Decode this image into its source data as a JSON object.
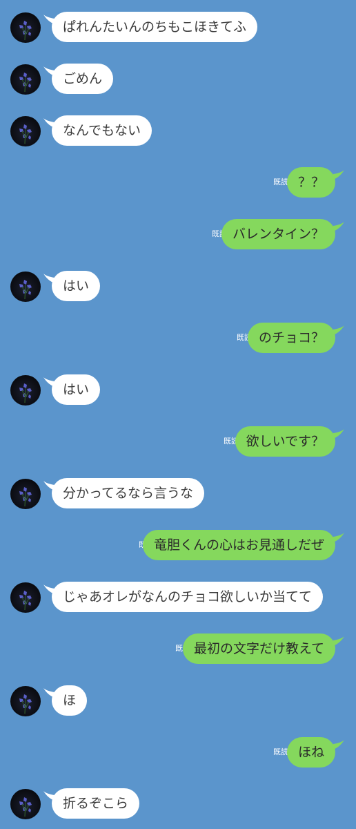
{
  "read_label": "既読",
  "colors": {
    "background": "#5b95cc",
    "incoming_bubble": "#ffffff",
    "outgoing_bubble": "#85d85d",
    "read_text": "#ffffff"
  },
  "avatar_icon": "flower-avatar-icon",
  "messages": [
    {
      "side": "in",
      "text": "ぱれんたいんのちもこほきてふ"
    },
    {
      "side": "in",
      "text": "ごめん"
    },
    {
      "side": "in",
      "text": "なんでもない"
    },
    {
      "side": "out",
      "text": "？？"
    },
    {
      "side": "out",
      "text": "バレンタイン？"
    },
    {
      "side": "in",
      "text": "はい"
    },
    {
      "side": "out",
      "text": "のチョコ？"
    },
    {
      "side": "in",
      "text": "はい"
    },
    {
      "side": "out",
      "text": "欲しいです？"
    },
    {
      "side": "in",
      "text": "分かってるなら言うな"
    },
    {
      "side": "out",
      "text": "竜胆くんの心はお見通しだぜ"
    },
    {
      "side": "in",
      "text": "じゃあオレがなんのチョコ欲しいか当てて"
    },
    {
      "side": "out",
      "text": "最初の文字だけ教えて"
    },
    {
      "side": "in",
      "text": "ほ"
    },
    {
      "side": "out",
      "text": "ほね"
    },
    {
      "side": "in",
      "text": "折るぞこら"
    }
  ]
}
